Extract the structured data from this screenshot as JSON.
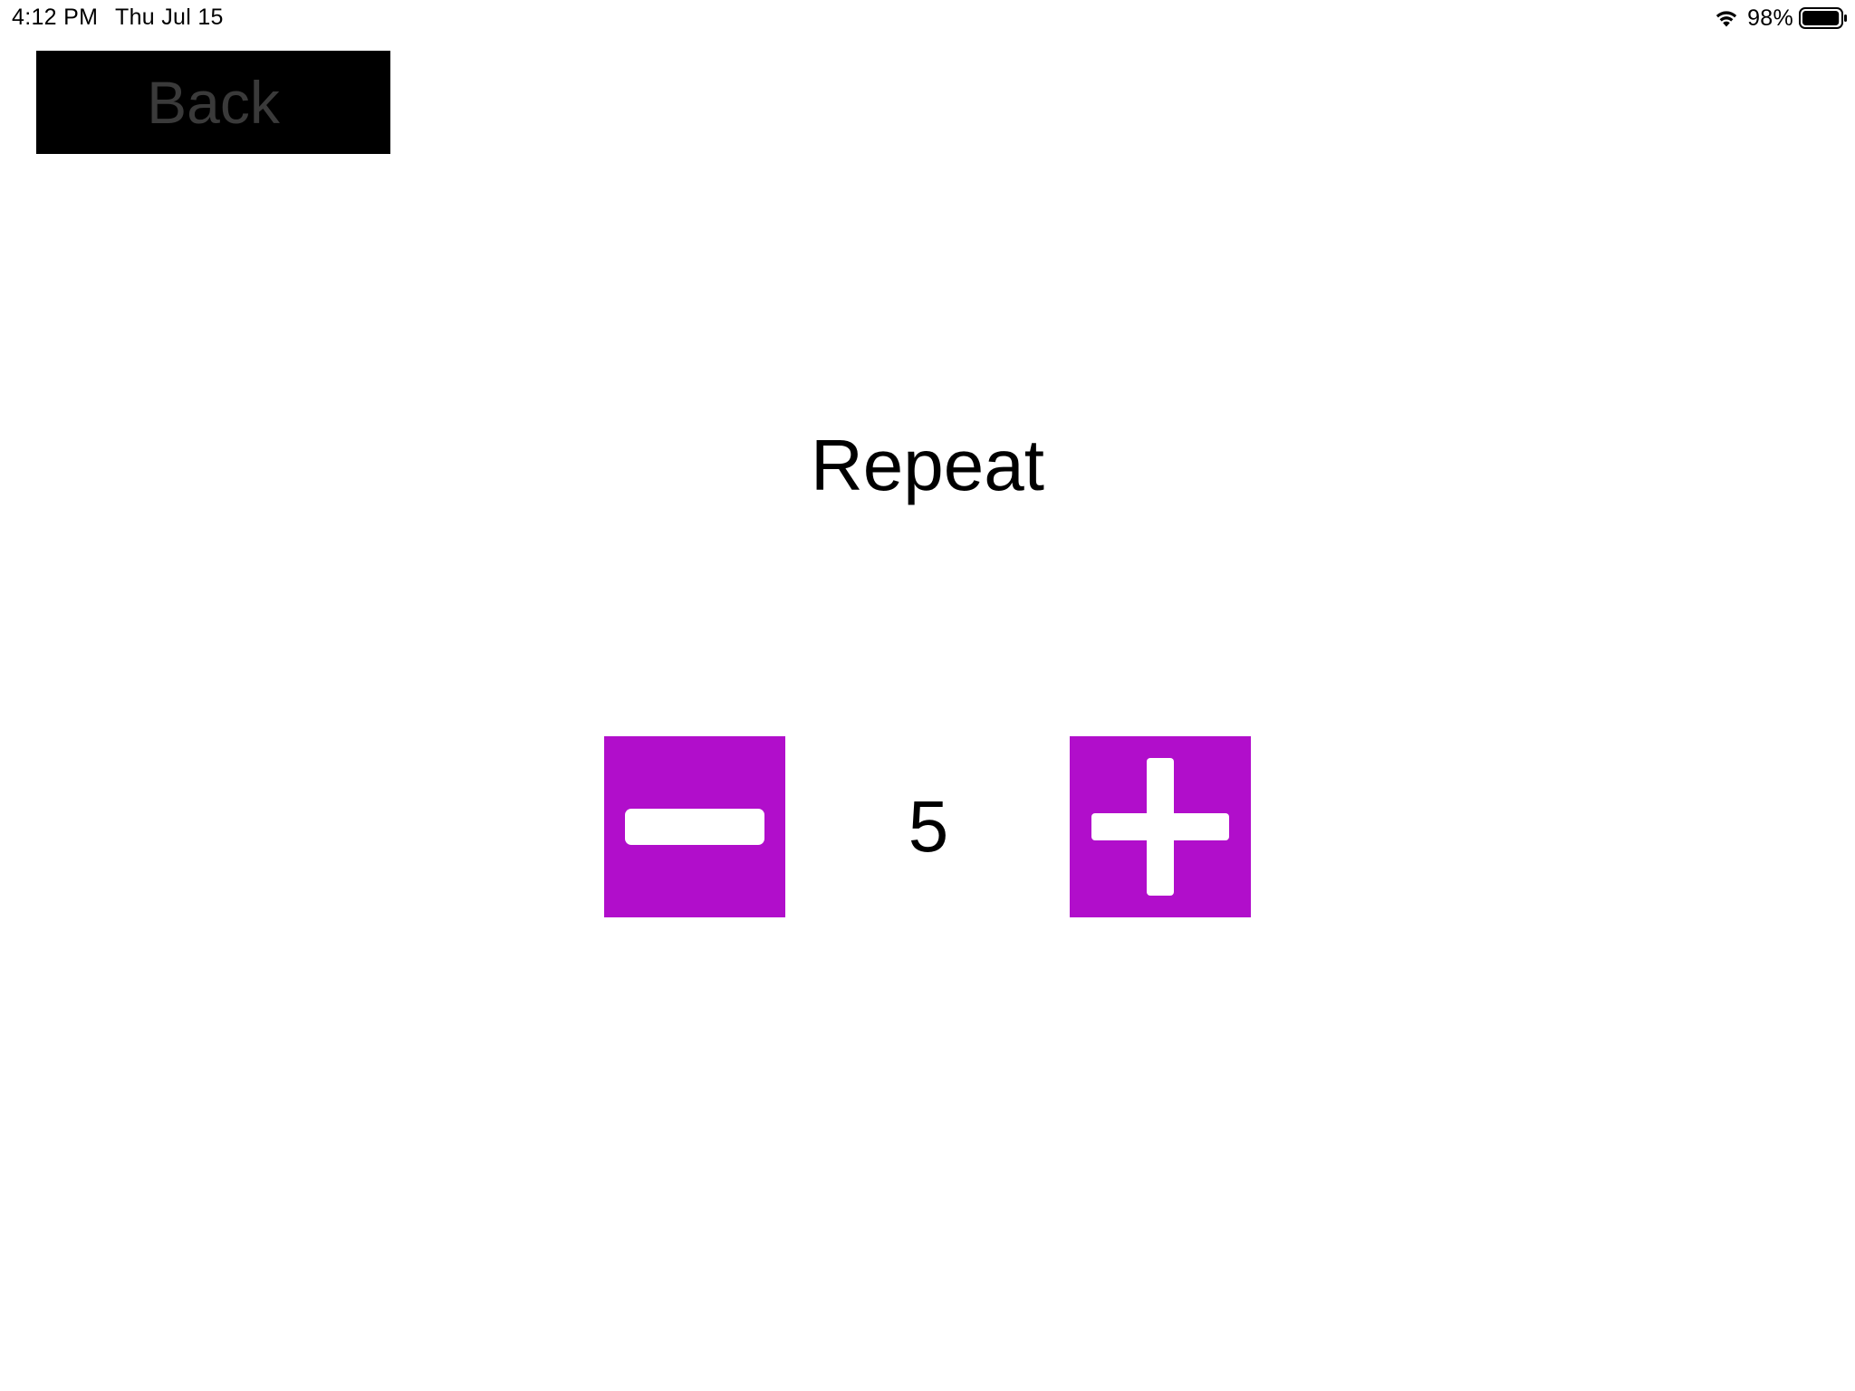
{
  "status_bar": {
    "time": "4:12 PM",
    "date": "Thu Jul 15",
    "battery_percent": "98%",
    "battery_level": 0.98,
    "wifi_icon": "wifi-icon",
    "battery_icon": "battery-icon"
  },
  "navigation": {
    "back_label": "Back"
  },
  "page": {
    "title": "Repeat"
  },
  "stepper": {
    "value": "5",
    "decrement_icon": "minus-icon",
    "increment_icon": "plus-icon"
  },
  "colors": {
    "accent": "#b10ecb",
    "back_button_background": "#000000",
    "back_button_text": "#3a3a3a"
  }
}
